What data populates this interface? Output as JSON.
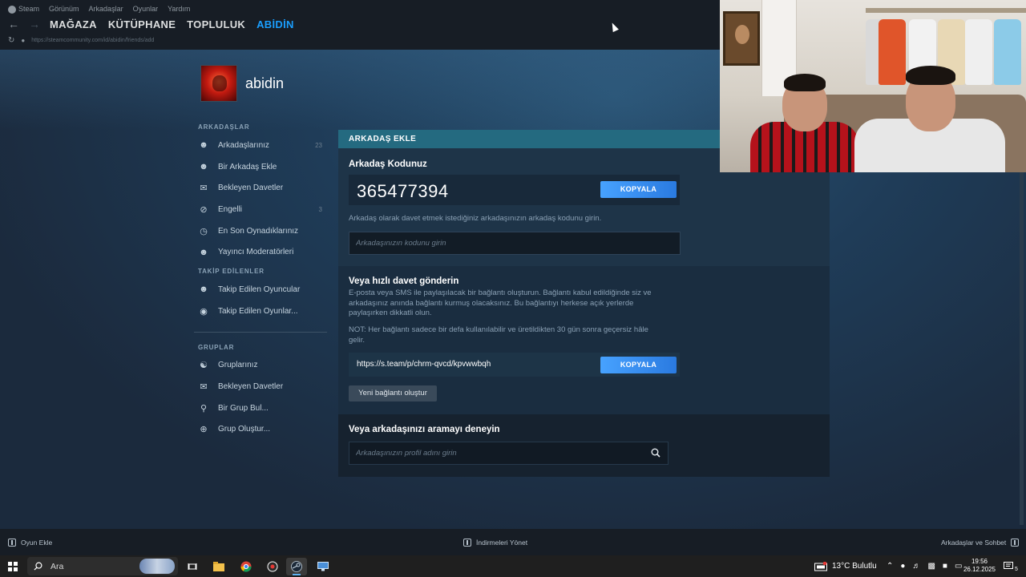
{
  "menu": [
    "Steam",
    "Görünüm",
    "Arkadaşlar",
    "Oyunlar",
    "Yardım"
  ],
  "nav": {
    "tabs": [
      "MAĞAZA",
      "KÜTÜPHANE",
      "TOPLULUK",
      "ABİDİN"
    ],
    "url": "https://steamcommunity.com/id/abidin/friends/add"
  },
  "profile": {
    "name": "abidin"
  },
  "sidebar": {
    "friends_heading": "ARKADAŞLAR",
    "friends_items": [
      {
        "label": "Arkadaşlarınız",
        "count": "23",
        "icon": "person-icon"
      },
      {
        "label": "Bir Arkadaş Ekle",
        "count": "",
        "icon": "person-add-icon"
      },
      {
        "label": "Bekleyen Davetler",
        "count": "",
        "icon": "envelope-icon"
      },
      {
        "label": "Engelli",
        "count": "3",
        "icon": "block-icon"
      },
      {
        "label": "En Son Oynadıklarınız",
        "count": "",
        "icon": "clock-icon"
      },
      {
        "label": "Yayıncı Moderatörleri",
        "count": "",
        "icon": "person-icon"
      }
    ],
    "following_heading": "TAKİP EDİLENLER",
    "following_items": [
      {
        "label": "Takip Edilen Oyuncular",
        "icon": "person-follow-icon"
      },
      {
        "label": "Takip Edilen Oyunlar...",
        "icon": "controller-icon"
      }
    ],
    "groups_heading": "GRUPLAR",
    "groups_items": [
      {
        "label": "Gruplarınız",
        "icon": "group-icon"
      },
      {
        "label": "Bekleyen Davetler",
        "icon": "envelope-icon"
      },
      {
        "label": "Bir Grup Bul...",
        "icon": "search-icon"
      },
      {
        "label": "Grup Oluştur...",
        "icon": "plus-circle-icon"
      }
    ]
  },
  "panel": {
    "header": "ARKADAŞ EKLE",
    "code_title": "Arkadaş Kodunuz",
    "friend_code": "365477394",
    "copy_label": "KOPYALA",
    "code_hint": "Arkadaş olarak davet etmek istediğiniz arkadaşınızın arkadaş kodunu girin.",
    "code_placeholder": "Arkadaşınızın kodunu girin",
    "invite_title": "Veya hızlı davet gönderin",
    "invite_desc_1": "E-posta veya SMS ile paylaşılacak bir bağlantı oluşturun. Bağlantı kabul edildiğinde siz ve",
    "invite_desc_2": "arkadaşınız anında bağlantı kurmuş olacaksınız. Bu bağlantıyı herkese açık yerlerde",
    "invite_desc_3": "paylaşırken dikkatli olun.",
    "invite_note_1": "NOT: Her bağlantı sadece bir defa kullanılabilir ve üretildikten 30 gün sonra geçersiz hâle",
    "invite_note_2": "gelir.",
    "invite_link": "https://s.team/p/chrm-qvcd/kpvwwbqh",
    "new_link_label": "Yeni bağlantı oluştur",
    "search_title": "Veya arkadaşınızı aramayı deneyin",
    "search_placeholder": "Arkadaşınızın profil adını girin"
  },
  "bottombar": {
    "add_game": "Oyun Ekle",
    "downloads": "İndirmeleri Yönet",
    "friends_chat": "Arkadaşlar ve Sohbet"
  },
  "taskbar": {
    "search_label": "Ara",
    "weather": "13°C  Bulutlu",
    "time": "19:56",
    "date": "26.12.2025",
    "notification_count": "5"
  },
  "colors": {
    "accent": "#1a9fff",
    "panel_header": "#246a80",
    "button_blue": "#3b8ff0"
  }
}
